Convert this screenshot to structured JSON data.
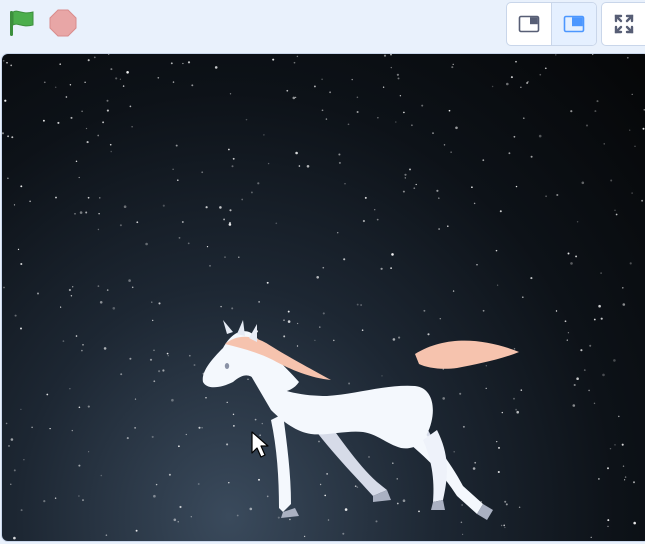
{
  "toolbar": {
    "green_flag": {
      "icon": "green-flag-icon",
      "color": "#4cae4c"
    },
    "stop": {
      "icon": "stop-sign-icon",
      "color": "#e8a6a6"
    },
    "stage_layouts": [
      {
        "icon": "small-stage-icon",
        "active": false
      },
      {
        "icon": "large-stage-icon",
        "active": true
      }
    ],
    "fullscreen": {
      "icon": "fullscreen-icon"
    }
  },
  "stage": {
    "backdrop": "starry-night-sky",
    "sprite": "unicorn",
    "colors": {
      "sky_dark": "#050607",
      "sky_light": "#3a4a5c",
      "unicorn_body": "#f4f8fd",
      "unicorn_mane": "#f6c3ae",
      "accent_blue": "#4c97ff"
    }
  }
}
